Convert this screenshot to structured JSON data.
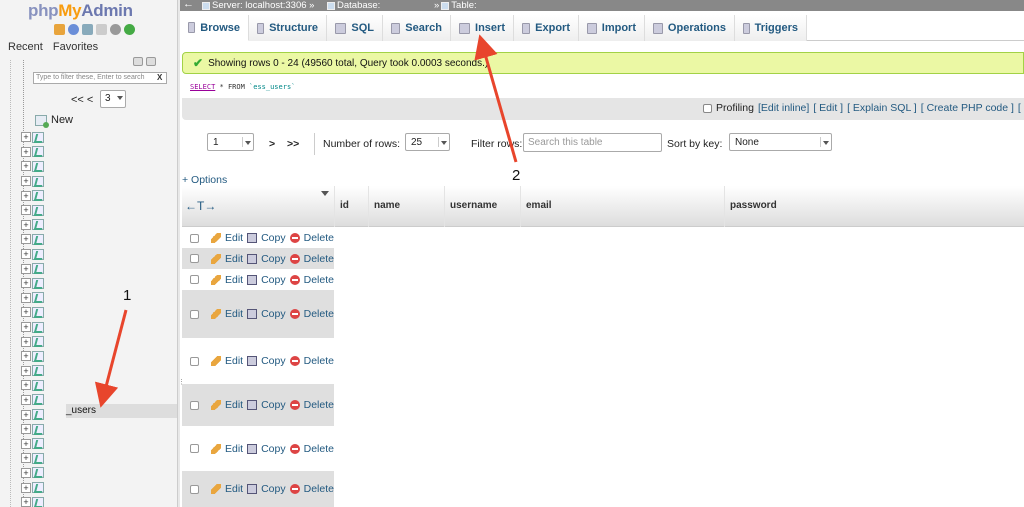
{
  "nav": {
    "logo_php": "php",
    "logo_my": "My",
    "logo_admin": "Admin",
    "tabs": [
      "Recent",
      "Favorites"
    ],
    "filter_placeholder": "Type to filter these, Enter to search",
    "filter_clear": "X",
    "pager_prev": "<< <",
    "pager_page": "3",
    "new_label": "New",
    "selected_table": "_users",
    "tree_count": 26
  },
  "topbar": {
    "back_arrow": "←",
    "server": "Server: localhost:3306 »",
    "database": "Database:",
    "table_sep": "»",
    "table": "Table:"
  },
  "menu": {
    "tabs": [
      "Browse",
      "Structure",
      "SQL",
      "Search",
      "Insert",
      "Export",
      "Import",
      "Operations",
      "Triggers"
    ]
  },
  "success": {
    "message": "Showing rows 0 - 24 (49560 total, Query took 0.0003 seconds.)"
  },
  "sql": {
    "select": "SELECT",
    "rest": " * FROM ",
    "table": "`ess_users`"
  },
  "profiling": {
    "label": "Profiling",
    "links": [
      "[Edit inline]",
      "[ Edit ]",
      "[ Explain SQL ]",
      "[ Create PHP code ]",
      "[ R"
    ]
  },
  "controls": {
    "page_value": "1",
    "next": ">",
    "last": ">>",
    "rows_label": "Number of rows:",
    "rows_value": "25",
    "filter_label": "Filter rows:",
    "filter_placeholder": "Search this table",
    "sort_label": "Sort by key:",
    "sort_value": "None"
  },
  "table": {
    "options_label": "+ Options",
    "resize_glyph": "←T→",
    "columns": [
      "id",
      "name",
      "username",
      "email",
      "password"
    ],
    "row_actions": {
      "edit": "Edit",
      "copy": "Copy",
      "delete": "Delete"
    },
    "row_count": 8
  },
  "annotations": {
    "label1": "1",
    "label2": "2",
    "arrow_color": "#e8452c"
  },
  "colors": {
    "link": "#235a81",
    "success_bg": "#ebf8a4",
    "topbar_bg": "#888888"
  }
}
